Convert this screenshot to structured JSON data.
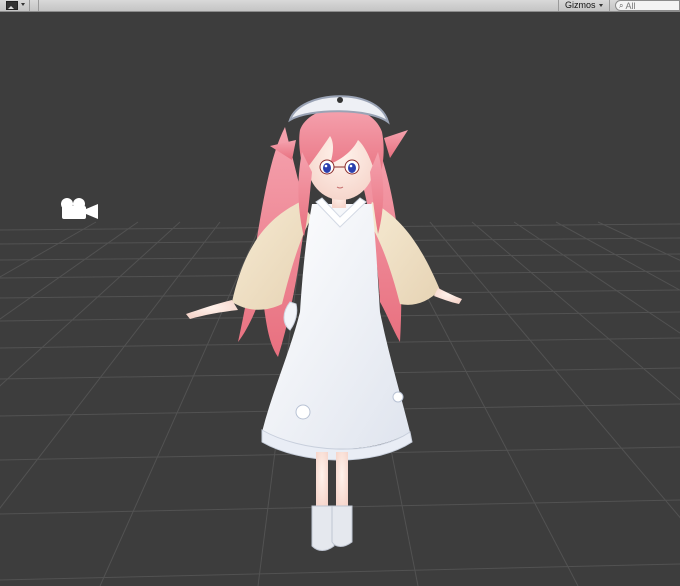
{
  "toolbar": {
    "gizmos_label": "Gizmos",
    "search_placeholder": "All",
    "image_mode_icon": "image-icon",
    "dropdown_icon": "caret-down-icon",
    "search_icon": "search-icon"
  },
  "viewport": {
    "camera_icon": "camera-icon",
    "character": "character-model"
  },
  "colors": {
    "toolbar_bg": "#c8c8c8",
    "viewport_bg": "#3d3d3d",
    "grid_line": "#4f4f4f",
    "hair": "#f08a9a",
    "dress": "#f4f6fa",
    "kimono": "#efe2c8"
  }
}
